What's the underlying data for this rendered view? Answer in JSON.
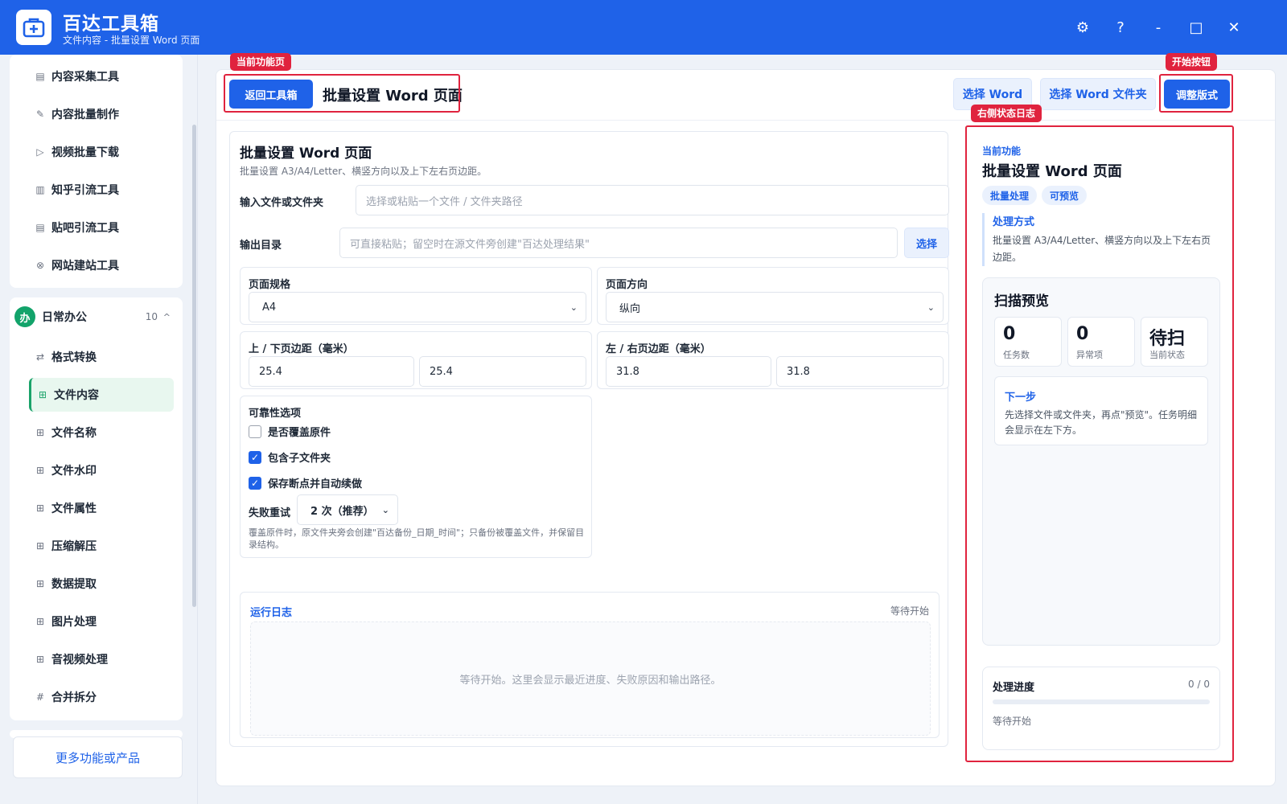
{
  "app": {
    "title": "百达工具箱",
    "subtitle": "文件内容 - 批量设置 Word 页面"
  },
  "window_controls": {
    "settings": "⚙",
    "help": "?",
    "minimize": "-",
    "maximize": "□",
    "close": "✕"
  },
  "sidebar": {
    "tools_items": [
      {
        "label": "内容采集工具",
        "icon": "clipboard-icon",
        "glyph": "▤"
      },
      {
        "label": "内容批量制作",
        "icon": "pen-icon",
        "glyph": "✎"
      },
      {
        "label": "视频批量下载",
        "icon": "video-icon",
        "glyph": "▷"
      },
      {
        "label": "知乎引流工具",
        "icon": "zhihu-icon",
        "glyph": "▥"
      },
      {
        "label": "贴吧引流工具",
        "icon": "tieba-icon",
        "glyph": "▤"
      },
      {
        "label": "网站建站工具",
        "icon": "globe-icon",
        "glyph": "⊗"
      }
    ],
    "group": {
      "badge": "办",
      "title": "日常办公",
      "count": "10",
      "caret": "^"
    },
    "office_items": [
      {
        "label": "格式转换",
        "icon": "swap-icon",
        "glyph": "⇄"
      },
      {
        "label": "文件内容",
        "icon": "grid-icon",
        "glyph": "⊞",
        "active": true
      },
      {
        "label": "文件名称",
        "icon": "grid-icon",
        "glyph": "⊞"
      },
      {
        "label": "文件水印",
        "icon": "grid-icon",
        "glyph": "⊞"
      },
      {
        "label": "文件属性",
        "icon": "grid-icon",
        "glyph": "⊞"
      },
      {
        "label": "压缩解压",
        "icon": "grid-icon",
        "glyph": "⊞"
      },
      {
        "label": "数据提取",
        "icon": "grid-icon",
        "glyph": "⊞"
      },
      {
        "label": "图片处理",
        "icon": "grid-icon",
        "glyph": "⊞"
      },
      {
        "label": "音视频处理",
        "icon": "grid-icon",
        "glyph": "⊞"
      },
      {
        "label": "合并拆分",
        "icon": "hash-icon",
        "glyph": "#"
      }
    ],
    "more_label": "更多功能或产品"
  },
  "toolbar": {
    "back_label": "返回工具箱",
    "heading": "批量设置 Word 页面",
    "select_word": "选择 Word",
    "select_folder": "选择 Word 文件夹",
    "start_label": "调整版式"
  },
  "annotations": {
    "current_page": "当前功能页",
    "start_button": "开始按钮",
    "right_log": "右侧状态日志"
  },
  "form": {
    "title": "批量设置 Word 页面",
    "description": "批量设置 A3/A4/Letter、横竖方向以及上下左右页边距。",
    "input_label": "输入文件或文件夹",
    "input_placeholder": "选择或粘贴一个文件 / 文件夹路径",
    "output_label": "输出目录",
    "output_placeholder": "可直接粘贴；留空时在源文件旁创建\"百达处理结果\"",
    "output_select": "选择",
    "page_size": {
      "label": "页面规格",
      "value": "A4"
    },
    "orientation": {
      "label": "页面方向",
      "value": "纵向"
    },
    "tb_margin": {
      "label": "上 / 下页边距（毫米）",
      "top": "25.4",
      "bottom": "25.4"
    },
    "lr_margin": {
      "label": "左 / 右页边距（毫米）",
      "left": "31.8",
      "right": "31.8"
    },
    "reliability": {
      "label": "可靠性选项",
      "options": [
        {
          "label": "是否覆盖原件",
          "checked": false
        },
        {
          "label": "包含子文件夹",
          "checked": true
        },
        {
          "label": "保存断点并自动续做",
          "checked": true
        }
      ],
      "retry_label": "失败重试",
      "retry_value": "2 次（推荐）",
      "note": "覆盖原件时，原文件夹旁会创建\"百达备份_日期_时间\"；只备份被覆盖文件，并保留目录结构。"
    }
  },
  "log": {
    "title": "运行日志",
    "status": "等待开始",
    "placeholder": "等待开始。这里会显示最近进度、失败原因和输出路径。"
  },
  "right_panel": {
    "current_label": "当前功能",
    "title": "批量设置 Word 页面",
    "chips": [
      "批量处理",
      "可预览"
    ],
    "method_title": "处理方式",
    "method_desc": "批量设置 A3/A4/Letter、横竖方向以及上下左右页边距。",
    "scan": {
      "title": "扫描预览",
      "stats": [
        {
          "value": "0",
          "label": "任务数"
        },
        {
          "value": "0",
          "label": "异常项"
        },
        {
          "value": "待扫",
          "label": "当前状态"
        }
      ],
      "next_title": "下一步",
      "next_desc": "先选择文件或文件夹，再点\"预览\"。任务明细会显示在左下方。"
    },
    "progress": {
      "title": "处理进度",
      "count": "0 / 0",
      "fraction": 0,
      "status": "等待开始"
    }
  },
  "colors": {
    "brand": "#1f62e8",
    "accent_green": "#1aa36a",
    "annotation_red": "#e0233e"
  }
}
